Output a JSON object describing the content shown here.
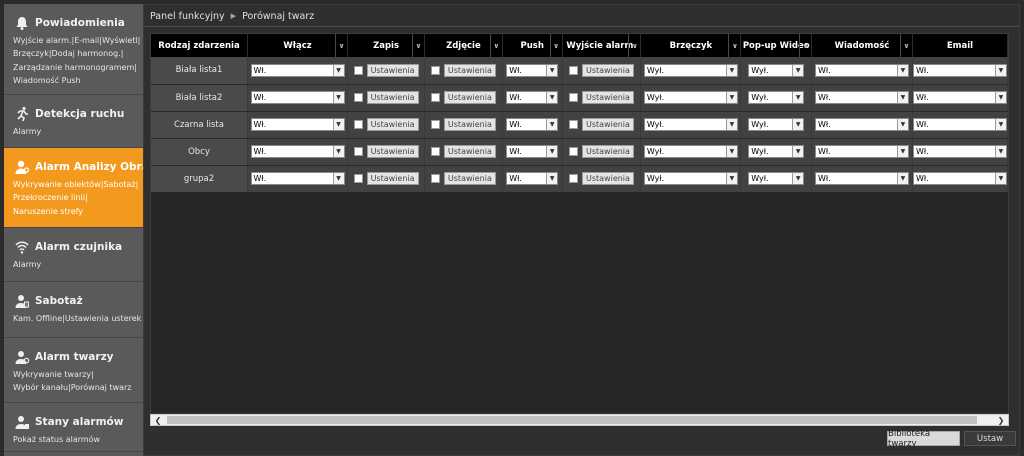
{
  "breadcrumb": {
    "root": "Panel funkcyjny",
    "current": "Porównaj twarz"
  },
  "sidebar": {
    "sections": [
      {
        "title": "Powiadomienia",
        "icon": "bell-icon",
        "active": false,
        "links": [
          "Wyjście alarm.|E-mail|Wyświetl|",
          "Brzęczyk|Dodaj harmonog.|",
          "Zarządzanie harmonogramem|",
          "Wiadomość Push"
        ]
      },
      {
        "title": "Detekcja ruchu",
        "icon": "running-man-icon",
        "active": false,
        "links": [
          "Alarmy"
        ]
      },
      {
        "title": "Alarm Analizy Obrazu",
        "icon": "analytics-icon",
        "active": true,
        "links": [
          "Wykrywanie obiektów|Sabotaż|",
          "Przekroczenie linii|",
          "Naruszenie strefy"
        ]
      },
      {
        "title": "Alarm czujnika",
        "icon": "sensor-icon",
        "active": false,
        "links": [
          "Alarmy"
        ]
      },
      {
        "title": "Sabotaż",
        "icon": "tamper-icon",
        "active": false,
        "links": [
          "Kam. Offline|Ustawienia usterek"
        ]
      },
      {
        "title": "Alarm twarzy",
        "icon": "face-icon",
        "active": false,
        "links": [
          "Wykrywanie twarzy|",
          "Wybór kanału|Porównaj twarz"
        ]
      },
      {
        "title": "Stany alarmów",
        "icon": "alarm-status-icon",
        "active": false,
        "links": [
          "Pokaż status alarmów"
        ]
      }
    ]
  },
  "table": {
    "columns": [
      "Rodzaj zdarzenia",
      "Włącz",
      "Zapis",
      "Zdjęcie",
      "Push",
      "Wyjście alarm.",
      "Brzęczyk",
      "Pop-up Wideo",
      "Wiadomość",
      "Email"
    ],
    "settings_label": "Ustawienia",
    "rows": [
      {
        "name": "Biała lista1",
        "enable": "Wł.",
        "push": "Wł.",
        "buzzer": "Wył.",
        "popup": "Wył.",
        "message": "Wł.",
        "email": "Wł."
      },
      {
        "name": "Biała lista2",
        "enable": "Wł.",
        "push": "Wł.",
        "buzzer": "Wył.",
        "popup": "Wył.",
        "message": "Wł.",
        "email": "Wł."
      },
      {
        "name": "Czarna lista",
        "enable": "Wł.",
        "push": "Wł.",
        "buzzer": "Wył.",
        "popup": "Wył.",
        "message": "Wł.",
        "email": "Wł."
      },
      {
        "name": "Obcy",
        "enable": "Wł.",
        "push": "Wł.",
        "buzzer": "Wył.",
        "popup": "Wył.",
        "message": "Wł.",
        "email": "Wł."
      },
      {
        "name": "grupa2",
        "enable": "Wł.",
        "push": "Wł.",
        "buzzer": "Wył.",
        "popup": "Wył.",
        "message": "Wł.",
        "email": "Wł."
      }
    ]
  },
  "buttons": {
    "library": "Biblioteka twarzy",
    "apply": "Ustaw"
  },
  "colors": {
    "accent": "#f39a1e",
    "sidebar": "#5a5a5a",
    "header": "#000000"
  }
}
